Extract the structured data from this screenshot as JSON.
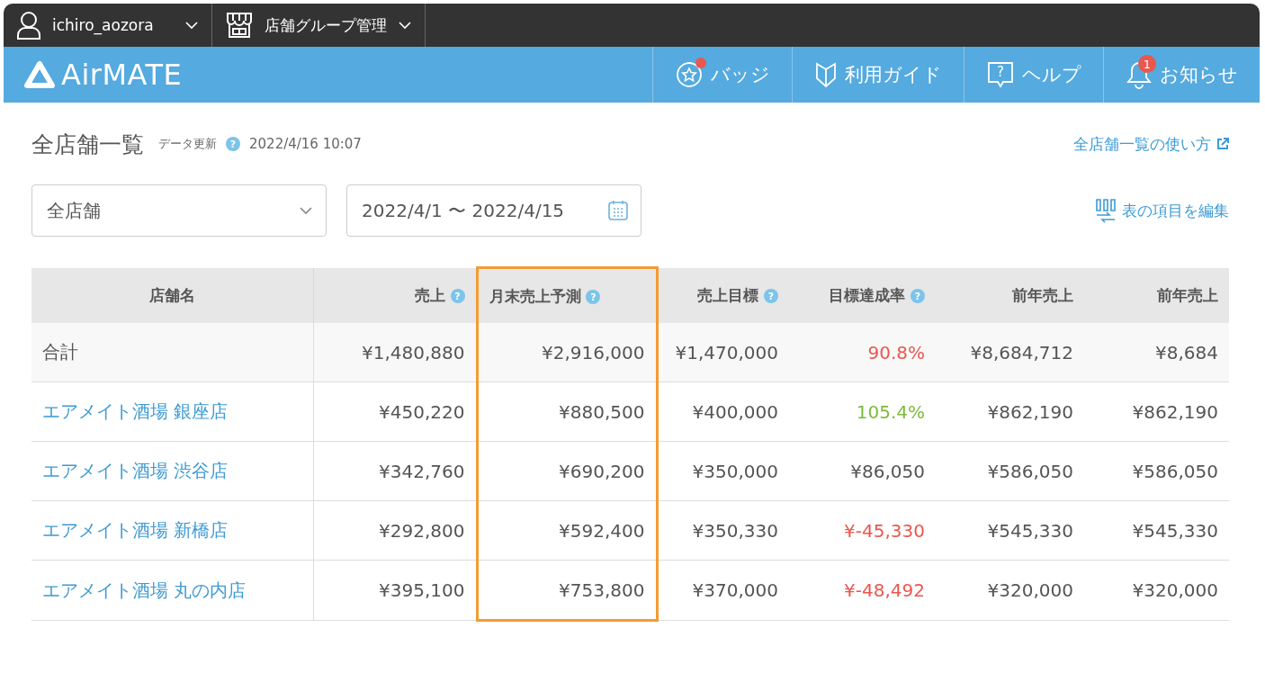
{
  "topbar": {
    "user": "ichiro_aozora",
    "group": "店舗グループ管理"
  },
  "header": {
    "logo": "AirMATE",
    "nav": [
      {
        "kind": "badge",
        "label": "バッジ",
        "dot": true
      },
      {
        "kind": "guide",
        "label": "利用ガイド",
        "dot": false
      },
      {
        "kind": "help",
        "label": "ヘルプ",
        "icon_text": "?",
        "dot": false
      },
      {
        "kind": "notice",
        "label": "お知らせ",
        "dot": false,
        "count": "1"
      }
    ]
  },
  "page": {
    "title": "全店舗一覧",
    "update_label": "データ更新",
    "update_help": "?",
    "update_time": "2022/4/16 10:07",
    "help_link": "全店舗一覧の使い方",
    "store_select": "全店舗",
    "date_range": "2022/4/1 〜 2022/4/15",
    "edit_columns": "表の項目を編集"
  },
  "table": {
    "columns": [
      {
        "label": "店舗名",
        "highlighted": false
      },
      {
        "label": "売上",
        "help": "?",
        "highlighted": false
      },
      {
        "label": "月末売上予測",
        "help": "?",
        "highlighted": true
      },
      {
        "label": "売上目標",
        "help": "?",
        "highlighted": false
      },
      {
        "label": "目標達成率",
        "help": "?",
        "highlighted": false
      },
      {
        "label": "前年売上",
        "highlighted": false
      },
      {
        "label": "前年売上",
        "highlighted": false
      }
    ],
    "rows": [
      {
        "kind": "total",
        "cells": [
          {
            "text": "合計",
            "color": "#555555"
          },
          {
            "text": "¥1,480,880",
            "color": "#555555"
          },
          {
            "text": "¥2,916,000",
            "color": "#555555"
          },
          {
            "text": "¥1,470,000",
            "color": "#555555"
          },
          {
            "text": "90.8%",
            "color": "#e8584f"
          },
          {
            "text": "¥8,684,712",
            "color": "#555555"
          },
          {
            "text": "¥8,684",
            "color": "#555555"
          }
        ]
      },
      {
        "kind": "store",
        "cells": [
          {
            "text": "エアメイト酒場 銀座店",
            "color": "#3d9bd4"
          },
          {
            "text": "¥450,220",
            "color": "#555555"
          },
          {
            "text": "¥880,500",
            "color": "#555555"
          },
          {
            "text": "¥400,000",
            "color": "#555555"
          },
          {
            "text": "105.4%",
            "color": "#7dbb3c"
          },
          {
            "text": "¥862,190",
            "color": "#555555"
          },
          {
            "text": "¥862,190",
            "color": "#555555"
          }
        ]
      },
      {
        "kind": "store",
        "cells": [
          {
            "text": "エアメイト酒場 渋谷店",
            "color": "#3d9bd4"
          },
          {
            "text": "¥342,760",
            "color": "#555555"
          },
          {
            "text": "¥690,200",
            "color": "#555555"
          },
          {
            "text": "¥350,000",
            "color": "#555555"
          },
          {
            "text": "¥86,050",
            "color": "#555555"
          },
          {
            "text": "¥586,050",
            "color": "#555555"
          },
          {
            "text": "¥586,050",
            "color": "#555555"
          }
        ]
      },
      {
        "kind": "store",
        "cells": [
          {
            "text": "エアメイト酒場 新橋店",
            "color": "#3d9bd4"
          },
          {
            "text": "¥292,800",
            "color": "#555555"
          },
          {
            "text": "¥592,400",
            "color": "#555555"
          },
          {
            "text": "¥350,330",
            "color": "#555555"
          },
          {
            "text": "¥-45,330",
            "color": "#e8584f"
          },
          {
            "text": "¥545,330",
            "color": "#555555"
          },
          {
            "text": "¥545,330",
            "color": "#555555"
          }
        ]
      },
      {
        "kind": "store",
        "cells": [
          {
            "text": "エアメイト酒場 丸の内店",
            "color": "#3d9bd4"
          },
          {
            "text": "¥395,100",
            "color": "#555555"
          },
          {
            "text": "¥753,800",
            "color": "#555555"
          },
          {
            "text": "¥370,000",
            "color": "#555555"
          },
          {
            "text": "¥-48,492",
            "color": "#e8584f"
          },
          {
            "text": "¥320,000",
            "color": "#555555"
          },
          {
            "text": "¥320,000",
            "color": "#555555"
          }
        ]
      }
    ]
  }
}
